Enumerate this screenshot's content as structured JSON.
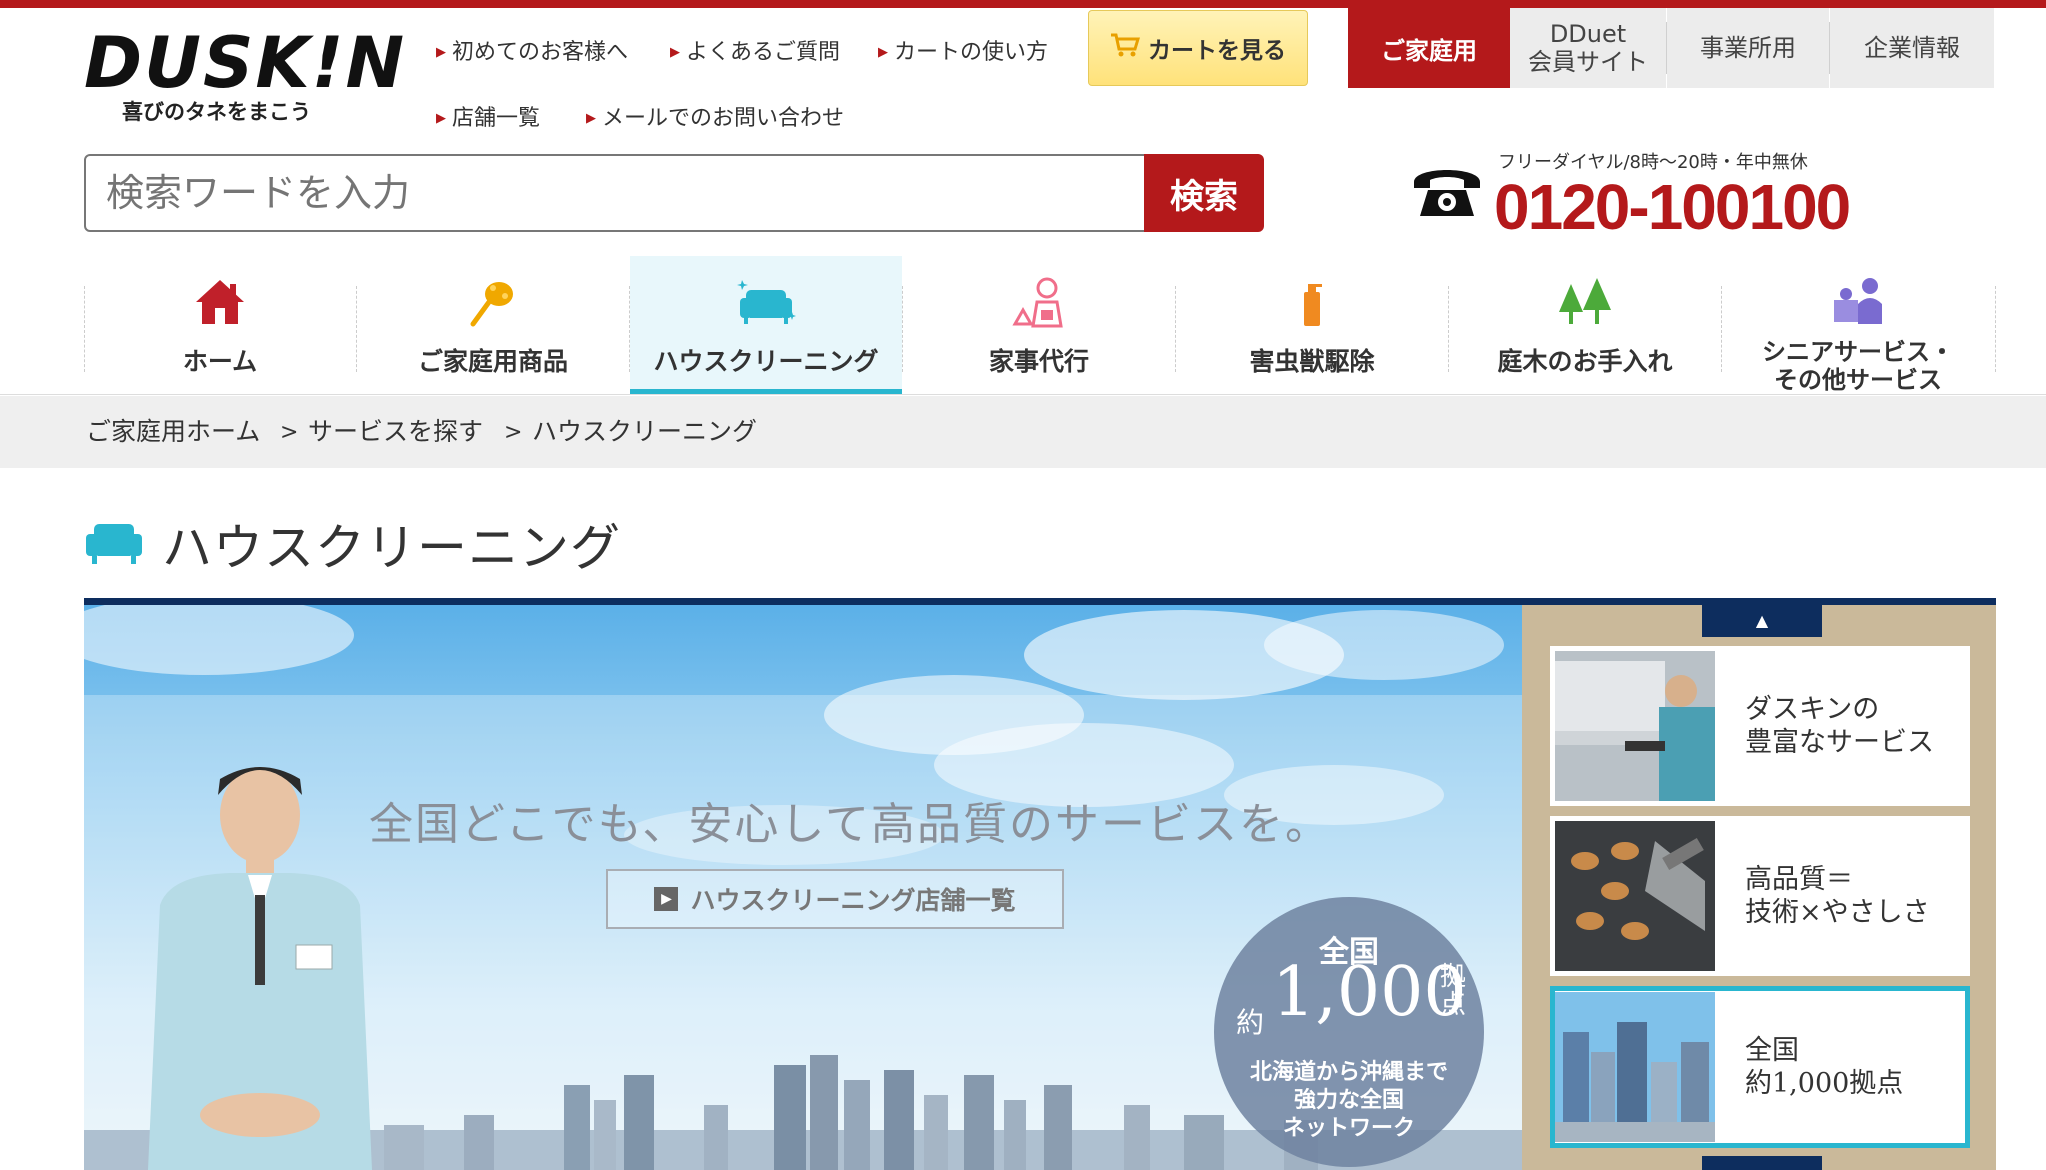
{
  "brand": {
    "logo_text": "DUSK!N",
    "tagline": "喜びのタネをまこう"
  },
  "header": {
    "links": [
      {
        "label": "初めてのお客様へ"
      },
      {
        "label": "よくあるご質問"
      },
      {
        "label": "カートの使い方"
      },
      {
        "label": "店舗一覧"
      },
      {
        "label": "メールでのお問い合わせ"
      }
    ],
    "cart_label": "カートを見る",
    "tabs": [
      {
        "label": "ご家庭用"
      },
      {
        "label": "DDuet\n会員サイト"
      },
      {
        "label": "事業所用"
      },
      {
        "label": "企業情報"
      }
    ]
  },
  "search": {
    "placeholder": "検索ワードを入力",
    "button_label": "検索"
  },
  "phone": {
    "note": "フリーダイヤル/8時〜20時・年中無休",
    "number": "0120-100100"
  },
  "categories": [
    {
      "label": "ホーム",
      "icon": "house-icon",
      "color": "#c0202a"
    },
    {
      "label": "ご家庭用商品",
      "icon": "duster-icon",
      "color": "#f0a800"
    },
    {
      "label": "ハウスクリーニング",
      "icon": "sofa-icon",
      "color": "#29b6cf",
      "active": true
    },
    {
      "label": "家事代行",
      "icon": "housekeeper-icon",
      "color": "#f06e8a"
    },
    {
      "label": "害虫獣駆除",
      "icon": "spray-icon",
      "color": "#f08a20"
    },
    {
      "label": "庭木のお手入れ",
      "icon": "trees-icon",
      "color": "#4caa3a"
    },
    {
      "label": "シニアサービス・\nその他サービス",
      "icon": "senior-icon",
      "color": "#7a6bd0"
    }
  ],
  "breadcrumb": [
    "ご家庭用ホーム",
    "サービスを探す",
    "ハウスクリーニング"
  ],
  "breadcrumb_separator": ">",
  "page": {
    "title": "ハウスクリーニング"
  },
  "hero": {
    "tagline": "全国どこでも、安心して高品質のサービスを。",
    "link_label": "ハウスクリーニング店舗一覧",
    "badge": {
      "line1": "全国",
      "prefix": "約",
      "number": "1,000",
      "suffix": "拠点",
      "caption": "北海道から沖縄まで\n強力な全国\nネットワーク"
    }
  },
  "side_cards": [
    {
      "text": "ダスキンの\n豊富なサービス"
    },
    {
      "text": "高品質＝\n技術×やさしさ"
    },
    {
      "text": "全国\n約1,000拠点",
      "active": true
    }
  ],
  "colors": {
    "brand_red": "#b4191b",
    "accent_cyan": "#29b6cf",
    "navy": "#0d2d5e"
  }
}
